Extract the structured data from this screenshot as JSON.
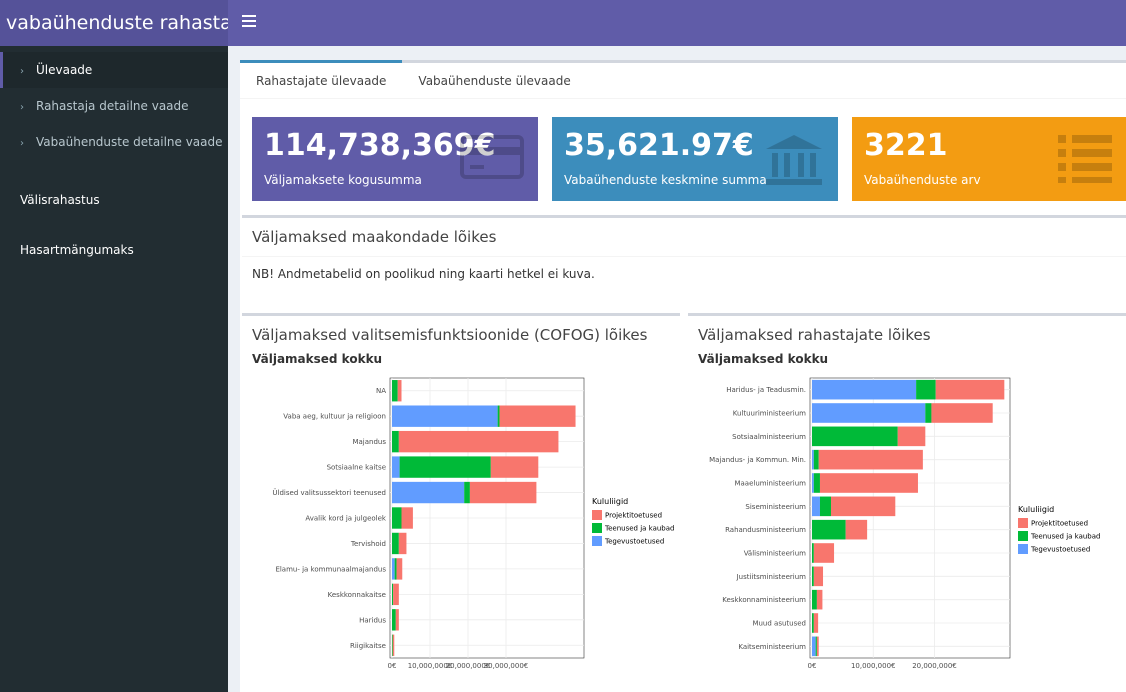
{
  "header": {
    "title": "vabaühenduste rahastamine",
    "menu_icon": "hamburger-icon"
  },
  "sidebar": {
    "items": [
      {
        "label": "Ülevaade",
        "icon": "chevron-icon"
      },
      {
        "label": "Rahastaja detailne vaade",
        "icon": "chevron-icon"
      },
      {
        "label": "Vabaühenduste detailne vaade",
        "icon": "chevron-icon"
      },
      {
        "label": "Välisrahastus"
      },
      {
        "label": "Hasartmängumaks"
      }
    ]
  },
  "tabs": [
    {
      "label": "Rahastajate ülevaade"
    },
    {
      "label": "Vabaühenduste ülevaade"
    }
  ],
  "valueboxes": [
    {
      "value": "114,738,369€",
      "label": "Väljamaksete kogusumma",
      "icon": "credit-card-icon",
      "color": "#605ca8"
    },
    {
      "value": "35,621.97€",
      "label": "Vabaühenduste keskmine summa",
      "icon": "bank-icon",
      "color": "#3c8dbc"
    },
    {
      "value": "3221",
      "label": "Vabaühenduste arv",
      "icon": "list-icon",
      "color": "#f39c12"
    }
  ],
  "map_box": {
    "title": "Väljamaksed maakondade lõikes",
    "note": "NB! Andmetabelid on poolikud ning kaarti hetkel ei kuva."
  },
  "cofog_box": {
    "title": "Väljamaksed valitsemisfunktsioonide (COFOG) lõikes",
    "subtitle": "Väljamaksed kokku"
  },
  "funder_box": {
    "title": "Väljamaksed rahastajate lõikes",
    "subtitle": "Väljamaksed kokku"
  },
  "chart_data": [
    {
      "type": "bar",
      "orientation": "horizontal",
      "stacked": true,
      "categories": [
        "NA",
        "Vaba aeg, kultuur ja religioon",
        "Majandus",
        "Sotsiaalne kaitse",
        "Üldised valitsussektori teenused",
        "Avalik kord ja julgeolek",
        "Tervishoid",
        "Elamu- ja kommunaalmajandus",
        "Keskkonnakaitse",
        "Haridus",
        "Riigikaitse"
      ],
      "series": [
        {
          "name": "Tegevustoetused",
          "color": "#619cff",
          "values": [
            0,
            27800000,
            0,
            2000000,
            19000000,
            0,
            0,
            700000,
            0,
            0,
            0
          ]
        },
        {
          "name": "Teenused ja kaubad",
          "color": "#00ba38",
          "values": [
            1500000,
            500000,
            1800000,
            24000000,
            1500000,
            2500000,
            1800000,
            500000,
            300000,
            1000000,
            200000
          ]
        },
        {
          "name": "Projektitoetused",
          "color": "#f8766d",
          "values": [
            1000000,
            20000000,
            42000000,
            12500000,
            17500000,
            3000000,
            2000000,
            1500000,
            1500000,
            800000,
            400000
          ]
        }
      ],
      "xticks": [
        "0€",
        "10,000,000€",
        "20,000,000€",
        "30,000,000€"
      ],
      "xlim": [
        0,
        50000000
      ],
      "legend_title": "Kululiigid",
      "legend": [
        "Projektitoetused",
        "Teenused ja kaubad",
        "Tegevustoetused"
      ],
      "legend_position": "right",
      "grid": true
    },
    {
      "type": "bar",
      "orientation": "horizontal",
      "stacked": true,
      "categories": [
        "Haridus- ja Teadusmin.",
        "Kultuuriministeerium",
        "Sotsiaalministeerium",
        "Majandus- ja Kommun. Min.",
        "Maaeluministeerium",
        "Siseministeerium",
        "Rahandusministeerium",
        "Välisministeerium",
        "Justiitsministeerium",
        "Keskkonnaministeerium",
        "Muud asutused",
        "Kaitseministeerium"
      ],
      "series": [
        {
          "name": "Tegevustoetused",
          "color": "#619cff",
          "values": [
            17000000,
            18500000,
            0,
            300000,
            300000,
            1300000,
            0,
            0,
            0,
            0,
            0,
            600000
          ]
        },
        {
          "name": "Teenused ja kaubad",
          "color": "#00ba38",
          "values": [
            3200000,
            1000000,
            14000000,
            800000,
            1000000,
            1800000,
            5500000,
            300000,
            300000,
            800000,
            300000,
            200000
          ]
        },
        {
          "name": "Projektitoetused",
          "color": "#f8766d",
          "values": [
            11200000,
            10000000,
            4500000,
            17000000,
            16000000,
            10500000,
            3500000,
            3300000,
            1500000,
            900000,
            700000,
            300000
          ]
        }
      ],
      "xticks": [
        "0€",
        "10,000,000€",
        "20,000,000€"
      ],
      "xlim": [
        0,
        32000000
      ],
      "legend_title": "Kululiigid",
      "legend": [
        "Projektitoetused",
        "Teenused ja kaubad",
        "Tegevustoetused"
      ],
      "legend_position": "right",
      "grid": true
    }
  ]
}
